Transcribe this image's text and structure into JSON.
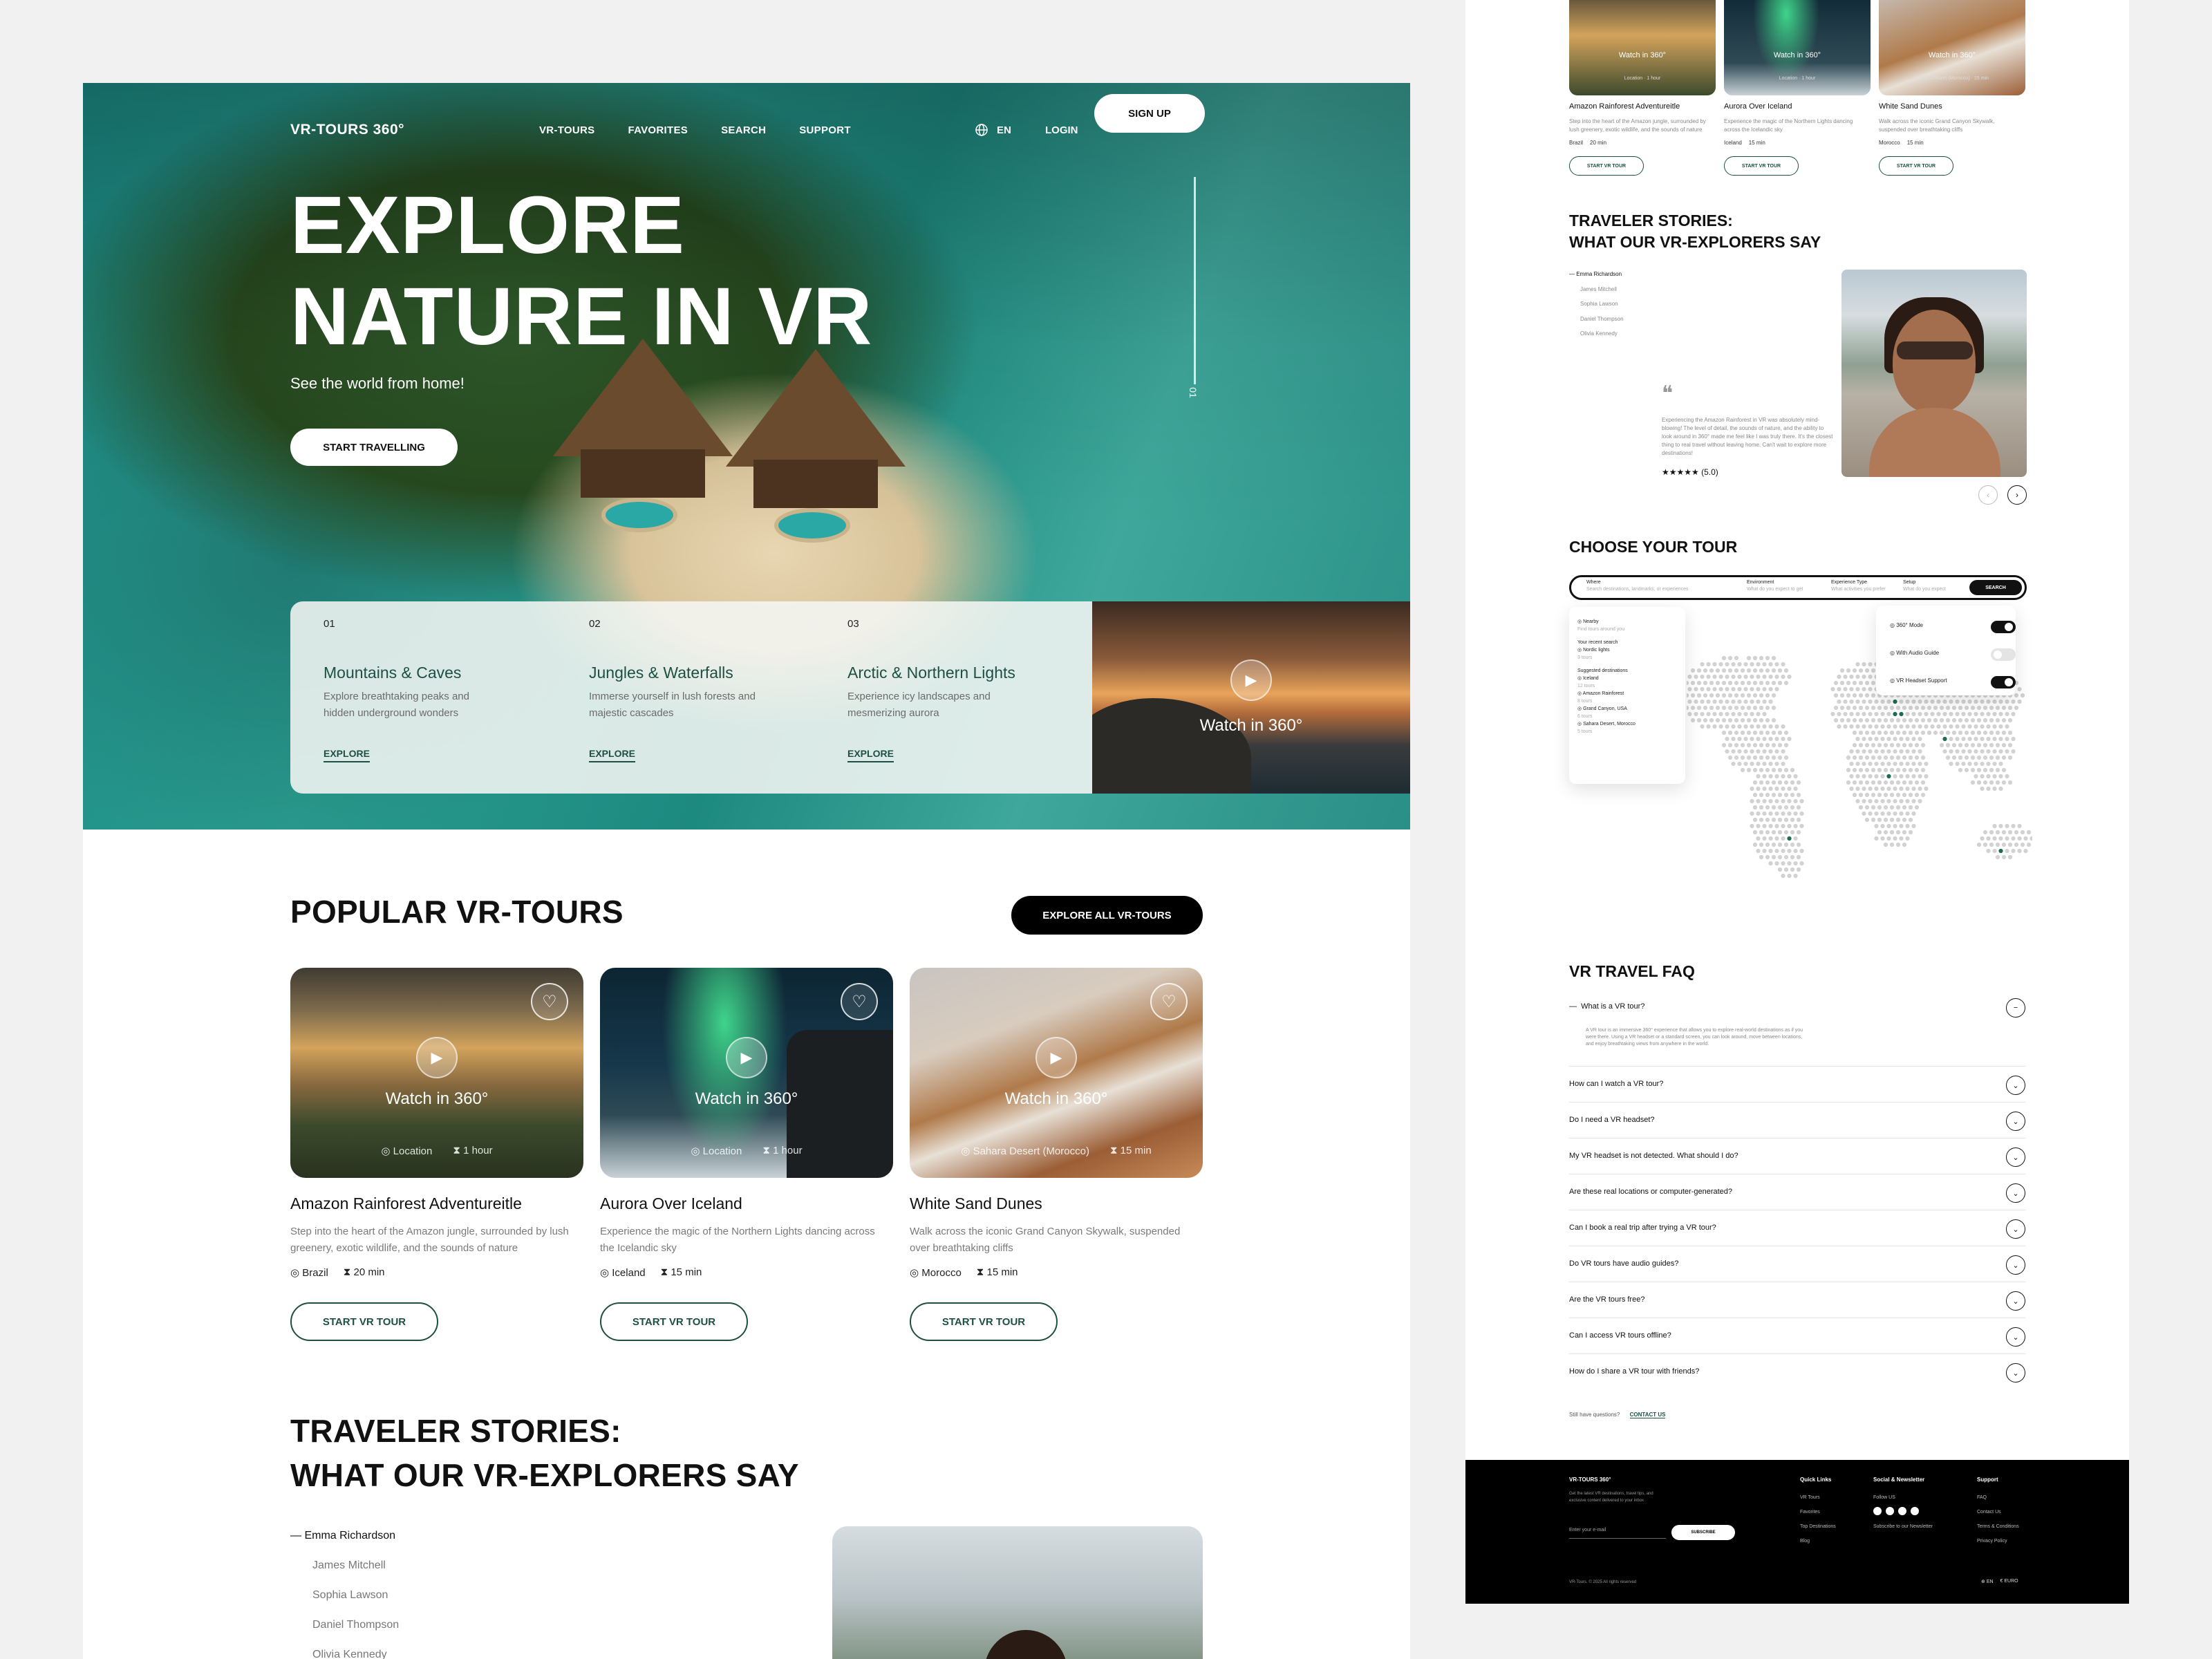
{
  "nav": {
    "brand": "VR-TOURS 360°",
    "links": [
      "VR-TOURS",
      "FAVORITES",
      "SEARCH",
      "SUPPORT"
    ],
    "lang": "EN",
    "login": "LOGIN",
    "signup": "SIGN UP"
  },
  "hero": {
    "title_line1": "EXPLORE",
    "title_line2": "NATURE IN VR",
    "subtitle": "See the world from home!",
    "cta": "START TRAVELLING",
    "slide_num": "01"
  },
  "categories": [
    {
      "num": "01",
      "title": "Mountains & Caves",
      "desc": "Explore breathtaking peaks and hidden underground wonders",
      "link": "EXPLORE"
    },
    {
      "num": "02",
      "title": "Jungles & Waterfalls",
      "desc": "Immerse yourself in lush forests and majestic cascades",
      "link": "EXPLORE"
    },
    {
      "num": "03",
      "title": "Arctic & Northern Lights",
      "desc": "Experience icy landscapes and mesmerizing aurora",
      "link": "EXPLORE"
    }
  ],
  "watch_label": "Watch in 360°",
  "popular": {
    "heading": "POPULAR VR-TOURS",
    "explore_all": "EXPLORE ALL VR-TOURS",
    "tours": [
      {
        "overlay_loc": "Location",
        "overlay_time": "1 hour",
        "title": "Amazon Rainforest Adventureitle",
        "desc": "Step into the heart of the Amazon jungle, surrounded by lush greenery, exotic wildlife, and the sounds of nature",
        "country": "Brazil",
        "duration": "20 min",
        "button": "START VR TOUR"
      },
      {
        "overlay_loc": "Location",
        "overlay_time": "1 hour",
        "title": "Aurora Over Iceland",
        "desc": "Experience the magic of the Northern Lights dancing across the Icelandic sky",
        "country": "Iceland",
        "duration": "15 min",
        "button": "START VR TOUR"
      },
      {
        "overlay_loc": "Sahara Desert (Morocco)",
        "overlay_time": "15 min",
        "title": "White Sand Dunes",
        "desc": "Walk across the iconic Grand Canyon Skywalk, suspended over breathtaking cliffs",
        "country": "Morocco",
        "duration": "15 min",
        "button": "START VR TOUR"
      }
    ]
  },
  "stories": {
    "heading_line1": "TRAVELER STORIES:",
    "heading_line2": "WHAT OUR VR-EXPLORERS SAY",
    "names": [
      "Emma Richardson",
      "James Mitchell",
      "Sophia Lawson",
      "Daniel Thompson",
      "Olivia Kennedy"
    ],
    "quote": "Experiencing the Amazon Rainforest in VR was absolutely mind-blowing! The level of detail, the sounds of nature, and the ability to look around in 360° made me feel like I was truly there. It's the closest thing to real travel without leaving home. Can't wait to explore more destinations!",
    "rating": "★★★★★ (5.0)"
  },
  "choose": {
    "heading": "CHOOSE YOUR TOUR",
    "fields": [
      {
        "label": "Where",
        "placeholder": "Search destinations, landmarks, or experiences"
      },
      {
        "label": "Environment",
        "placeholder": "What do you expect to get"
      },
      {
        "label": "Experience Type",
        "placeholder": "What activities you prefer"
      },
      {
        "label": "Setup",
        "placeholder": "What do you expect"
      }
    ],
    "search_btn": "SEARCH",
    "dropdown": {
      "nearby": "Nearby",
      "nearby_sub": "Find tours around you",
      "recent_label": "Your recent search",
      "recent": [
        {
          "name": "Nordic lights",
          "sub": "3 tours"
        }
      ],
      "suggested_label": "Suggested destinations",
      "suggested": [
        {
          "name": "Iceland",
          "sub": "12 tours"
        },
        {
          "name": "Amazon Rainforest",
          "sub": "8 tours"
        },
        {
          "name": "Grand Canyon, USA",
          "sub": "6 tours"
        },
        {
          "name": "Sahara Desert, Morocco",
          "sub": "5 tours"
        }
      ]
    },
    "toggles": [
      {
        "label": "360° Mode",
        "on": true
      },
      {
        "label": "With Audio Guide",
        "on": false
      },
      {
        "label": "VR Headset Support",
        "on": true
      }
    ]
  },
  "faq": {
    "heading": "VR TRAVEL FAQ",
    "open_q": "What is a VR tour?",
    "open_a": "A VR tour is an immersive 360° experience that allows you to explore real-world destinations as if you were there. Using a VR headset or a standard screen, you can look around, move between locations, and enjoy breathtaking views from anywhere in the world.",
    "questions": [
      "How can I watch a VR tour?",
      "Do I need a VR headset?",
      "My VR headset is not detected. What should I do?",
      "Are these real locations or computer-generated?",
      "Can I book a real trip after trying a VR tour?",
      "Do VR tours have audio guides?",
      "Are the VR tours free?",
      "Can I access VR tours offline?",
      "How do I share a VR tour with friends?"
    ],
    "still": "Still have questions?",
    "contact": "CONTACT US"
  },
  "footer": {
    "brand": "VR-TOURS 360°",
    "tagline": "Get the latest VR destinations, travel tips, and exclusive content delivered to your inbox",
    "email_placeholder": "Enter your e-mail",
    "subscribe": "SUBSCRIBE",
    "quick_title": "Quick Links",
    "quick": [
      "VR Tours",
      "Favorites",
      "Top Destinations",
      "Blog"
    ],
    "social_title": "Social & Newsletter",
    "follow": "Follow US",
    "subscribe_news": "Subscribe to our Newsletter",
    "support_title": "Support",
    "support": [
      "FAQ",
      "Contact Us",
      "Terms & Conditions",
      "Privacy Policy"
    ],
    "copyright": "VR-Tours. © 2025 All rights reserved",
    "lang": "EN",
    "currency": "€ EURO"
  },
  "colors": {
    "accent": "#1d4f43",
    "dark": "#111111",
    "map_dot": "#d2d2d2",
    "map_highlight": "#1f6b55"
  }
}
